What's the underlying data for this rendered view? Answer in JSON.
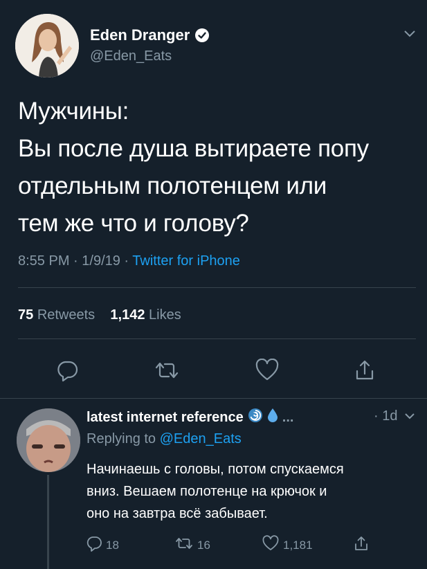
{
  "tweet": {
    "author_name": "Eden Dranger",
    "author_handle": "@Eden_Eats",
    "text_lines": [
      "Мужчины:",
      "Вы после душа вытираете попу",
      "отдельным полотенцем или",
      "тем же что и голову?"
    ],
    "time": "8:55 PM",
    "date": "1/9/19",
    "source": "Twitter for iPhone",
    "retweets_count": "75",
    "retweets_label": "Retweets",
    "likes_count": "1,142",
    "likes_label": "Likes"
  },
  "reply": {
    "author_name": "latest internet reference",
    "emojis": [
      "cyclone",
      "droplet"
    ],
    "ellipsis": "...",
    "time": "1d",
    "replying_prefix": "Replying to",
    "replying_to": "@Eden_Eats",
    "text_lines": [
      "Начинаешь с головы, потом спускаемся",
      "вниз. Вешаем полотенце на крючок и",
      "оно на завтра всё забывает."
    ],
    "reply_count": "18",
    "retweet_count": "16",
    "like_count": "1,181"
  },
  "icons": {
    "reply": "reply-icon",
    "retweet": "retweet-icon",
    "like": "heart-icon",
    "share": "share-icon",
    "verified": "verified-badge-icon",
    "caret": "chevron-down-icon"
  },
  "colors": {
    "background": "#15202b",
    "text": "#ffffff",
    "muted": "#8899a6",
    "link": "#1da1f2",
    "divider": "#38444d"
  }
}
